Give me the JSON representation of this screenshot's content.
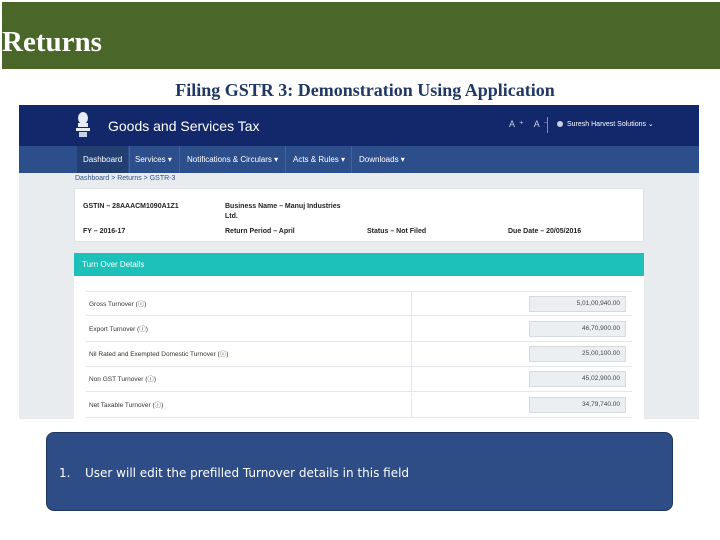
{
  "slide": {
    "title": "Returns",
    "subtitle": "Filing GSTR 3: Demonstration Using Application"
  },
  "colors": {
    "header_green": "#4a6629",
    "gst_topbar": "#13276b",
    "gst_nav": "#2c4f8c",
    "turnover_teal": "#1ec1b9",
    "callout_blue": "#2e4d86"
  },
  "portal": {
    "brand": "Goods and Services Tax",
    "header_icons": "A⁺ A⁻",
    "user_name": "Suresh Harvest Solutions ⌄",
    "emblem_icon": "national-emblem-icon",
    "nav": [
      {
        "label": "Dashboard"
      },
      {
        "label": "Services ▾"
      },
      {
        "label": "Notifications & Circulars ▾"
      },
      {
        "label": "Acts & Rules ▾"
      },
      {
        "label": "Downloads ▾"
      }
    ],
    "breadcrumb": "Dashboard  >  Returns  >  GSTR-3",
    "info": {
      "gstin": "GSTIN – 28AAACM1090A1Z1",
      "business_name_line1": "Business Name – Manuj Industries",
      "business_name_line2": "Ltd.",
      "fy": "FY – 2016-17",
      "return_period": "Return Period – April",
      "status": "Status – Not Filed",
      "due_date": "Due Date – 20/05/2016"
    },
    "turnover": {
      "title": "Turn Over Details",
      "rows": [
        {
          "label": "Gross Turnover (ⓘ)",
          "value": "5,01,00,940.00"
        },
        {
          "label": "Export Turnover (ⓘ)",
          "value": "46,70,900.00"
        },
        {
          "label": "Nil Rated and Exempted Domestic Turnover (ⓘ)",
          "value": "25,00,100.00"
        },
        {
          "label": "Non GST Turnover (ⓘ)",
          "value": "45,02,900.00"
        },
        {
          "label": "Net Taxable Turnover (ⓘ)",
          "value": "34,79,740.00"
        }
      ]
    }
  },
  "callout": {
    "number": "1.",
    "text": "User will edit the prefilled Turnover details in this field"
  }
}
